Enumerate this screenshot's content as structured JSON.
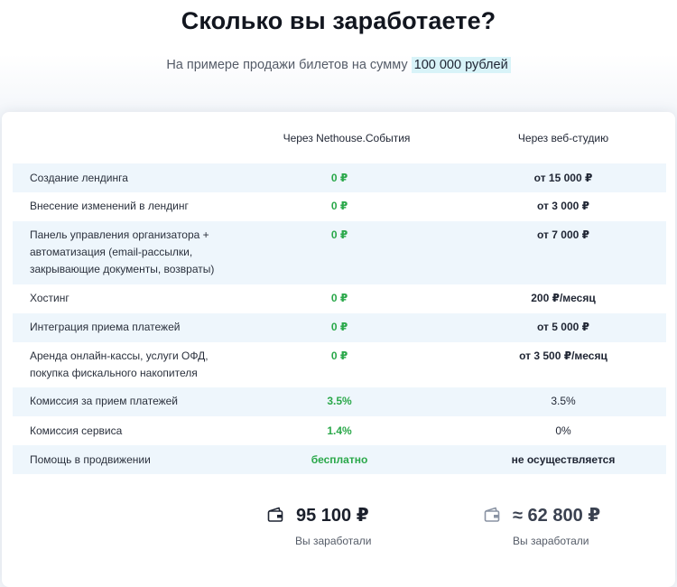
{
  "title": "Сколько вы заработаете?",
  "subtitle": {
    "text": "На примере продажи билетов на сумму",
    "highlight": "100 000 рублей"
  },
  "columns": {
    "nethouse": "Через Nethouse.События",
    "studio": "Через веб-студию"
  },
  "rows": [
    {
      "label": [
        "Создание лендинга"
      ],
      "nethouse": "0 ₽",
      "studio": "от 15 000 ₽"
    },
    {
      "label": [
        "Внесение изменений в лендинг"
      ],
      "nethouse": "0 ₽",
      "studio": "от 3 000 ₽"
    },
    {
      "label": [
        "Панель управления организатора +",
        "автоматизация (email-рассылки,",
        "закрывающие документы, возвраты)"
      ],
      "nethouse": "0 ₽",
      "studio": "от 7 000 ₽"
    },
    {
      "label": [
        "Хостинг"
      ],
      "nethouse": "0 ₽",
      "studio": "200 ₽/месяц"
    },
    {
      "label": [
        "Интеграция приема платежей"
      ],
      "nethouse": "0 ₽",
      "studio": "от 5 000 ₽"
    },
    {
      "label": [
        "Аренда онлайн-кассы, услуги ОФД,",
        "покупка фискального накопителя"
      ],
      "nethouse": "0 ₽",
      "studio": "от 3 500 ₽/месяц"
    },
    {
      "label": [
        "Комиссия за прием платежей"
      ],
      "nethouse": "3.5%",
      "studio": "3.5%"
    },
    {
      "label": [
        "Комиссия сервиса"
      ],
      "nethouse": "1.4%",
      "studio": "0%"
    },
    {
      "label": [
        "Помощь в продвижении"
      ],
      "nethouse": "бесплатно",
      "studio": "не осуществляется"
    }
  ],
  "summary": {
    "nethouse": {
      "amount": "95 100 ₽",
      "caption": "Вы заработали",
      "icon": "wallet-icon"
    },
    "studio": {
      "amount": "≈ 62 800 ₽",
      "caption": "Вы заработали",
      "icon": "wallet-icon"
    }
  },
  "colors": {
    "accent_green": "#2aa84a",
    "row_shade": "#eef6fc",
    "highlight": "#d8f3f8"
  }
}
